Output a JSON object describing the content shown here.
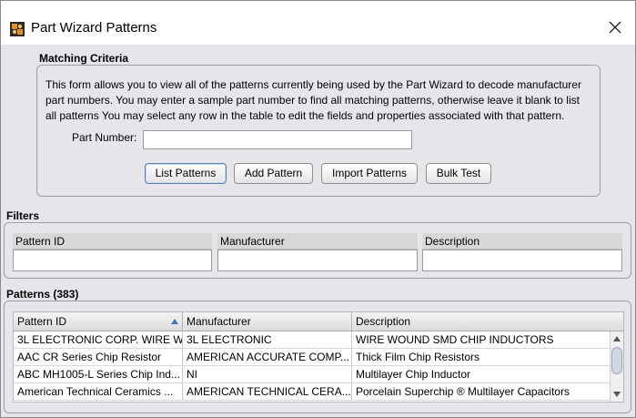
{
  "window": {
    "title": "Part Wizard Patterns"
  },
  "matching_criteria": {
    "label": "Matching Criteria",
    "description_lines": [
      "This form allows you to view all of the patterns currently being used by the Part Wizard to decode manufacturer",
      "part numbers. You may enter a sample part number to find all matching patterns, otherwise leave it blank to list",
      "all patterns You may select any row in the table to edit the fields and properties associated with that pattern."
    ],
    "part_number_label": "Part Number:",
    "part_number_value": "",
    "buttons": {
      "list_patterns": "List Patterns",
      "add_pattern": "Add Pattern",
      "import_patterns": "Import Patterns",
      "bulk_test": "Bulk Test"
    }
  },
  "filters": {
    "label": "Filters",
    "columns": [
      "Pattern ID",
      "Manufacturer",
      "Description"
    ],
    "values": [
      "",
      "",
      ""
    ]
  },
  "patterns": {
    "label": "Patterns (383)",
    "columns": [
      "Pattern ID",
      "Manufacturer",
      "Description"
    ],
    "sorted_column": "Pattern ID",
    "sort_direction": "ascending",
    "rows": [
      [
        "3L ELECTRONIC CORP. WIRE W...",
        "3L ELECTRONIC",
        "WIRE WOUND SMD CHIP INDUCTORS"
      ],
      [
        "AAC CR Series Chip Resistor",
        "AMERICAN ACCURATE COMP...",
        "Thick Film Chip Resistors"
      ],
      [
        "ABC MH1005-L Series Chip Ind...",
        "NI",
        "Multilayer Chip Inductor"
      ],
      [
        "American Technical Ceramics ...",
        "AMERICAN TECHNICAL CERA...",
        "Porcelain Superchip ® Multilayer Capacitors"
      ]
    ]
  },
  "icons": {
    "app": "puzzle-wizard-icon",
    "close": "close-icon",
    "sort": "sort-ascending-icon",
    "scroll_up": "scroll-up-icon",
    "scroll_down": "scroll-down-icon"
  },
  "colors": {
    "background": "#e6e6ea",
    "accent": "#3a6fc1",
    "app_icon_orange": "#e0902a"
  }
}
